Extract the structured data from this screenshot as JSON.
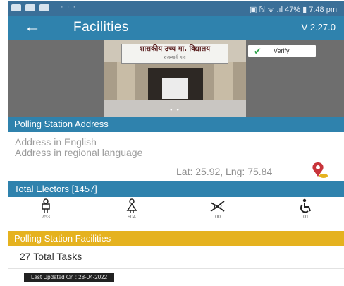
{
  "status_bar": {
    "right": "▣ ℕ ᯤ .ıl 47% ▮ 7:48 pm",
    "dots": "· · ·"
  },
  "app_bar": {
    "back_icon": "←",
    "title": "Facilities",
    "version": "V 2.27.0"
  },
  "photo": {
    "sign_text": "शासकीय उच्च मा. विद्यालय",
    "sign_subtext": "राजस्थानी गांव",
    "pager": "● ●"
  },
  "verify": {
    "icon": "✔",
    "label": "Verify"
  },
  "address_section": {
    "header": "Polling Station Address",
    "address_english": "Address in English",
    "address_regional": "Address in regional language",
    "coordinates": "Lat: 25.92, Lng: 75.84"
  },
  "electors_section": {
    "header": "Total Electors [1457]",
    "types": [
      {
        "icon": "male-icon",
        "count": "753"
      },
      {
        "icon": "female-icon",
        "count": "904"
      },
      {
        "icon": "third-gender-icon",
        "count": "00"
      },
      {
        "icon": "disabled-icon",
        "count": "01"
      }
    ]
  },
  "facilities_section": {
    "header": "Polling Station Facilities",
    "total_tasks": "27 Total Tasks"
  },
  "footer": {
    "last_updated": "Last Updated On : 28-04-2022"
  },
  "colors": {
    "status_bar": "#3a6f98",
    "app_bar": "#2f82ad",
    "section_blue": "#2f82ad",
    "section_gold": "#e5b21f",
    "verify_check": "#2fa24a",
    "pin_red": "#c8343a"
  }
}
